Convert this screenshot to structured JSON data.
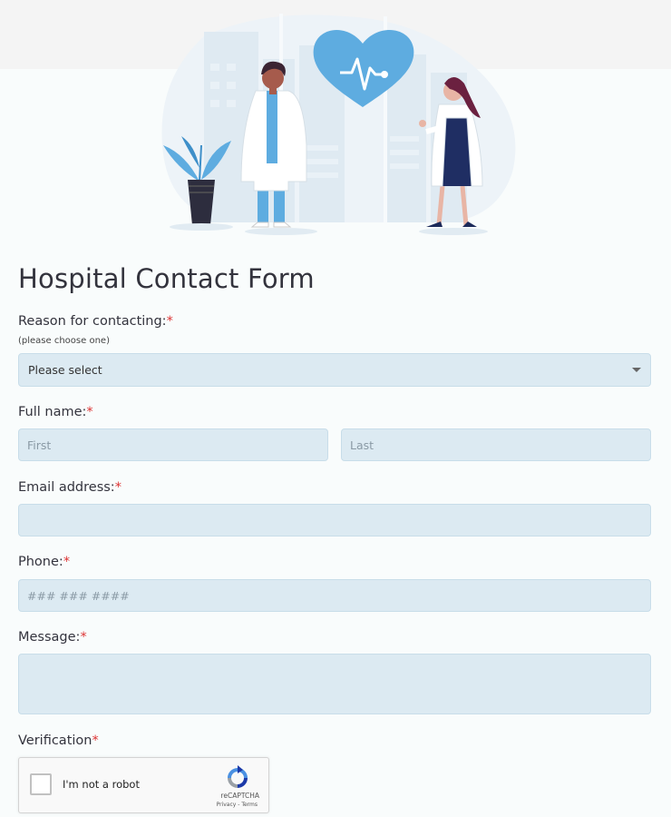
{
  "form": {
    "title": "Hospital Contact Form",
    "reason": {
      "label": "Reason for contacting:",
      "required_mark": "*",
      "hint": "(please choose one)",
      "selected": "Please select"
    },
    "full_name": {
      "label": "Full name:",
      "required_mark": "*",
      "first_placeholder": "First",
      "last_placeholder": "Last"
    },
    "email": {
      "label": "Email address:",
      "required_mark": "*"
    },
    "phone": {
      "label": "Phone:",
      "required_mark": "*",
      "placeholder": "### ### ####"
    },
    "message": {
      "label": "Message:",
      "required_mark": "*"
    },
    "verification": {
      "label": "Verification",
      "required_mark": "*"
    }
  },
  "recaptcha": {
    "label": "I'm not a robot",
    "brand": "reCAPTCHA",
    "privacy": "Privacy",
    "separator": " - ",
    "terms": "Terms"
  },
  "colors": {
    "field_bg": "#dceaf2",
    "accent_blue": "#5eace0",
    "required": "#dd3333"
  }
}
